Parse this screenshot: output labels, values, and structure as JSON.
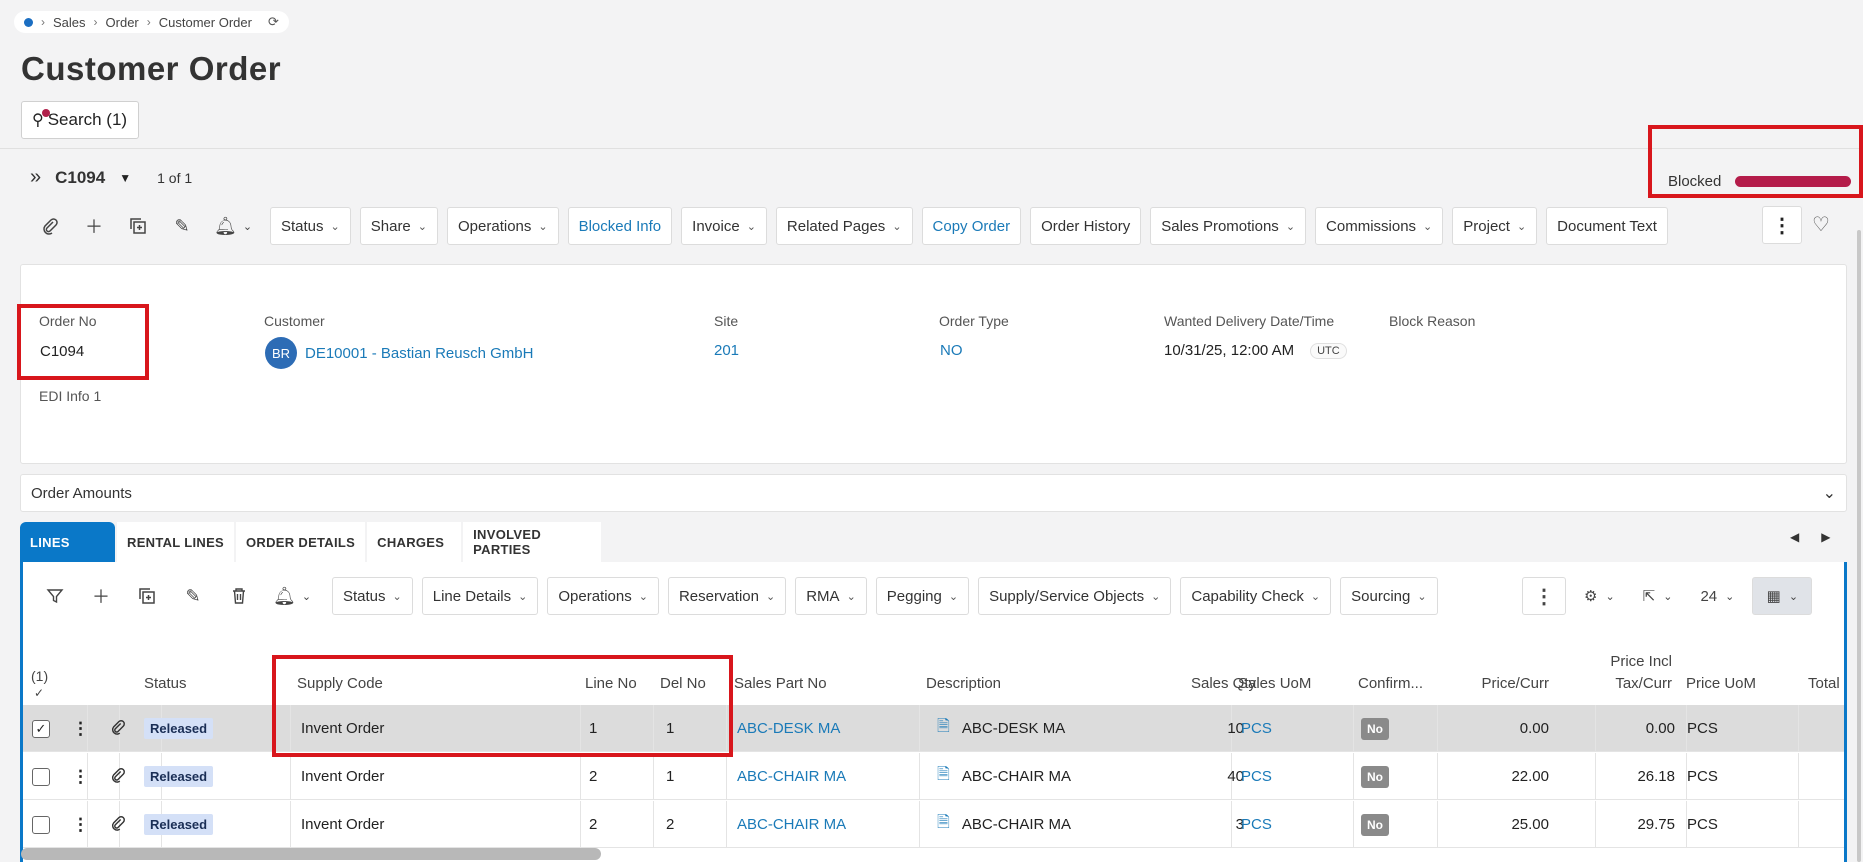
{
  "breadcrumb": {
    "items": [
      "Sales",
      "Order",
      "Customer Order"
    ]
  },
  "page": {
    "title": "Customer Order"
  },
  "search": {
    "label": "Search (1)"
  },
  "record": {
    "id": "C1094",
    "count": "1 of 1",
    "state_label": "Blocked",
    "state_color": "#b41c4a"
  },
  "toolbar": {
    "buttons": [
      {
        "label": "Status",
        "dropdown": true
      },
      {
        "label": "Share",
        "dropdown": true
      },
      {
        "label": "Operations",
        "dropdown": true
      },
      {
        "label": "Blocked Info",
        "dropdown": false
      },
      {
        "label": "Invoice",
        "dropdown": true
      },
      {
        "label": "Related Pages",
        "dropdown": true
      },
      {
        "label": "Copy Order",
        "dropdown": false
      },
      {
        "label": "Order History",
        "dropdown": false
      },
      {
        "label": "Sales Promotions",
        "dropdown": true
      },
      {
        "label": "Commissions",
        "dropdown": true
      },
      {
        "label": "Project",
        "dropdown": true
      },
      {
        "label": "Document Text",
        "dropdown": false
      }
    ]
  },
  "header": {
    "order_no_label": "Order No",
    "order_no": "C1094",
    "customer_label": "Customer",
    "customer_initials": "BR",
    "customer": "DE10001 - Bastian Reusch GmbH",
    "site_label": "Site",
    "site": "201",
    "order_type_label": "Order Type",
    "order_type": "NO",
    "wanted_delivery_label": "Wanted Delivery Date/Time",
    "wanted_delivery": "10/31/25, 12:00 AM",
    "timezone": "UTC",
    "block_reason_label": "Block Reason",
    "edi_label": "EDI Info 1"
  },
  "amounts": {
    "label": "Order Amounts"
  },
  "tabs": [
    "LINES",
    "RENTAL LINES",
    "ORDER DETAILS",
    "CHARGES",
    "INVOLVED PARTIES"
  ],
  "lines_toolbar": {
    "buttons": [
      "Status",
      "Line Details",
      "Operations",
      "Reservation",
      "RMA",
      "Pegging",
      "Supply/Service Objects",
      "Capability Check",
      "Sourcing"
    ],
    "page_size": "24"
  },
  "table": {
    "selected_count": "(1)",
    "columns": {
      "status": "Status",
      "supply_code": "Supply Code",
      "line_no": "Line No",
      "del_no": "Del No",
      "sales_part_no": "Sales Part No",
      "description": "Description",
      "sales_qty": "Sales Qty",
      "sales_uom": "Sales UoM",
      "confirm": "Confirm...",
      "price_curr": "Price/Curr",
      "price_incl_1": "Price Incl",
      "price_incl_2": "Tax/Curr",
      "price_uom": "Price UoM",
      "total": "Total"
    },
    "rows": [
      {
        "status": "Released",
        "supply_code": "Invent Order",
        "line_no": "1",
        "del_no": "1",
        "sales_part_no": "ABC-DESK MA",
        "description": "ABC-DESK MA",
        "sales_qty": "10",
        "sales_uom": "PCS",
        "confirm": "No",
        "price_curr": "0.00",
        "price_incl": "0.00",
        "price_uom": "PCS"
      },
      {
        "status": "Released",
        "supply_code": "Invent Order",
        "line_no": "2",
        "del_no": "1",
        "sales_part_no": "ABC-CHAIR MA",
        "description": "ABC-CHAIR MA",
        "sales_qty": "40",
        "sales_uom": "PCS",
        "confirm": "No",
        "price_curr": "22.00",
        "price_incl": "26.18",
        "price_uom": "PCS"
      },
      {
        "status": "Released",
        "supply_code": "Invent Order",
        "line_no": "2",
        "del_no": "2",
        "sales_part_no": "ABC-CHAIR MA",
        "description": "ABC-CHAIR MA",
        "sales_qty": "3",
        "sales_uom": "PCS",
        "confirm": "No",
        "price_curr": "25.00",
        "price_incl": "29.75",
        "price_uom": "PCS"
      }
    ]
  }
}
